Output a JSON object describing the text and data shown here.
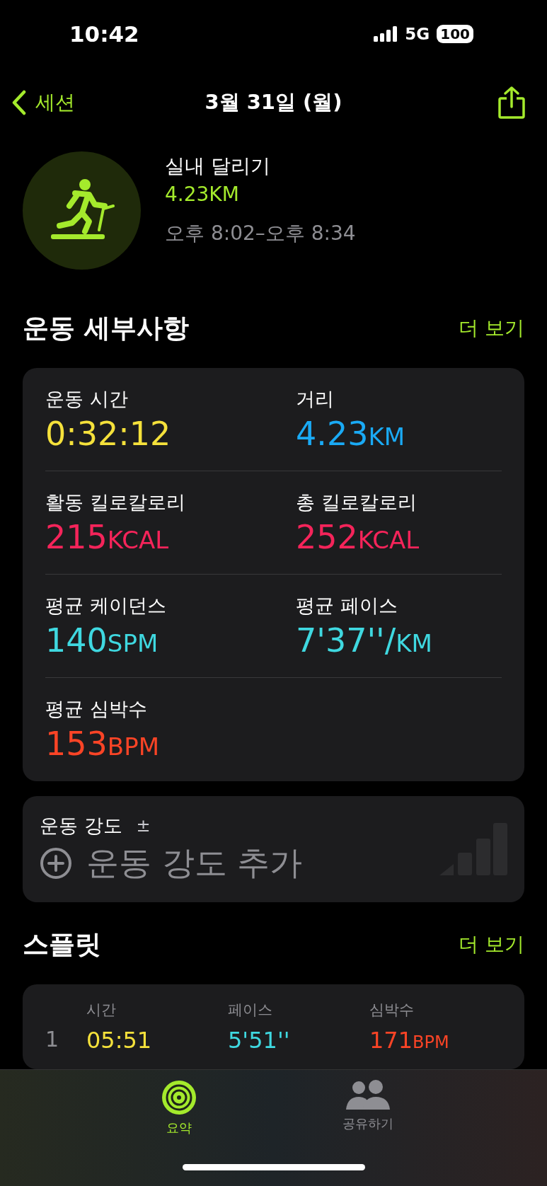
{
  "status_bar": {
    "time": "10:42",
    "network": "5G",
    "battery": "100"
  },
  "nav": {
    "back_label": "세션",
    "title": "3월 31일 (월)"
  },
  "workout": {
    "name": "실내 달리기",
    "distance": "4.23KM",
    "time_range": "오후 8:02–오후 8:34"
  },
  "details": {
    "title": "운동 세부사항",
    "more": "더 보기",
    "metrics": [
      {
        "label": "운동 시간",
        "value": "0:32:12",
        "color": "#f5e13b"
      },
      {
        "label": "거리",
        "value": "4.23",
        "unit": "KM",
        "color": "#1aaaf5"
      },
      {
        "label": "활동 킬로칼로리",
        "value": "215",
        "unit": "KCAL",
        "color": "#f5245a"
      },
      {
        "label": "총 킬로칼로리",
        "value": "252",
        "unit": "KCAL",
        "color": "#f5245a"
      },
      {
        "label": "평균 케이던스",
        "value": "140",
        "unit": "SPM",
        "color": "#3fd8e0"
      },
      {
        "label": "평균 페이스",
        "value": "7'37''/",
        "unit": "KM",
        "color": "#3fd8e0"
      },
      {
        "label": "평균 심박수",
        "value": "153",
        "unit": "BPM",
        "color": "#fa4426"
      }
    ]
  },
  "intensity": {
    "label": "운동 강도",
    "symbol": "±",
    "add_label": "운동 강도 추가"
  },
  "splits": {
    "title": "스플릿",
    "more": "더 보기",
    "columns": [
      "시간",
      "페이스",
      "심박수"
    ],
    "rows": [
      {
        "index": "1",
        "time": "05:51",
        "pace": "5'51''",
        "heart_rate": "171",
        "heart_rate_unit": "BPM"
      }
    ]
  },
  "tabs": [
    {
      "label": "요약",
      "selected": true
    },
    {
      "label": "공유하기",
      "selected": false
    }
  ]
}
